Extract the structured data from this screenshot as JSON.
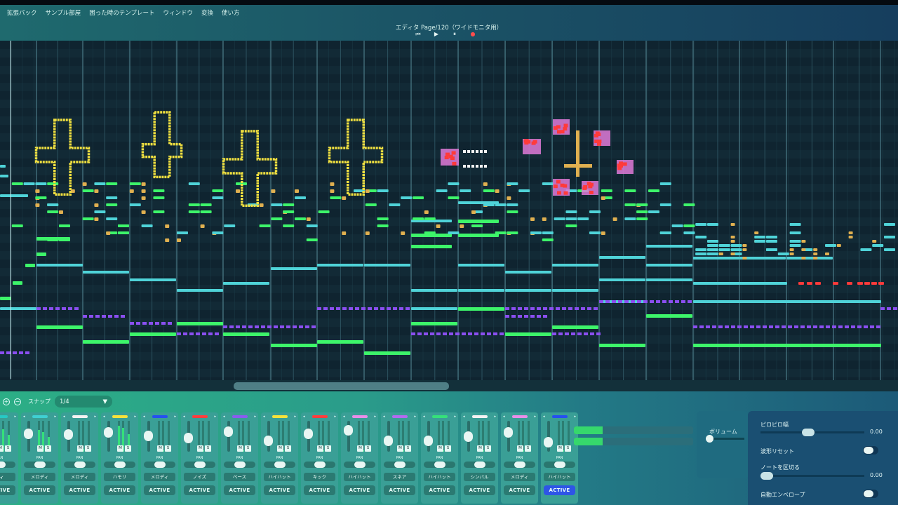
{
  "menubar": [
    "拡張パック",
    "サンプル部屋",
    "困った時のテンプレート",
    "ウィンドウ",
    "変換",
    "使い方"
  ],
  "editor_title": "エディタ Page/120（ワイドモニタ用）",
  "transport": {
    "prev": "⏮",
    "play": "▶",
    "pause": "⏸",
    "record": "●"
  },
  "snap": {
    "zoom_in": "+",
    "zoom_out": "−",
    "label": "スナップ",
    "value": "1/4",
    "caret": "▼"
  },
  "channels": [
    {
      "name": "ディ",
      "color": "#26c9c4",
      "fader": 0.7,
      "meter": 0.8,
      "pan": 0.5,
      "active": "ACTIVE",
      "on": false
    },
    {
      "name": "メロディ",
      "color": "#3fd0d2",
      "fader": 0.65,
      "meter": 0.7,
      "pan": 0.5,
      "active": "ACTIVE",
      "on": false
    },
    {
      "name": "メロディ",
      "color": "#f2f2f2",
      "fader": 0.6,
      "meter": 0.1,
      "pan": 0.5,
      "active": "ACTIVE",
      "on": false
    },
    {
      "name": "ハモリ",
      "color": "#f6e23b",
      "fader": 0.7,
      "meter": 0.85,
      "pan": 0.5,
      "active": "ACTIVE",
      "on": false
    },
    {
      "name": "メロディ",
      "color": "#2550f0",
      "fader": 0.55,
      "meter": 0.05,
      "pan": 0.5,
      "active": "ACTIVE",
      "on": false
    },
    {
      "name": "ノイズ",
      "color": "#ff3d3d",
      "fader": 0.45,
      "meter": 0.05,
      "pan": 0.5,
      "active": "ACTIVE",
      "on": false
    },
    {
      "name": "ベース",
      "color": "#8a5cf0",
      "fader": 0.75,
      "meter": 0.05,
      "pan": 0.5,
      "active": "ACTIVE",
      "on": false
    },
    {
      "name": "ハイハット",
      "color": "#f6e23b",
      "fader": 0.3,
      "meter": 0.05,
      "pan": 0.5,
      "active": "ACTIVE",
      "on": false
    },
    {
      "name": "キック",
      "color": "#ff3d3d",
      "fader": 0.65,
      "meter": 0.05,
      "pan": 0.5,
      "active": "ACTIVE",
      "on": false
    },
    {
      "name": "ハイハット",
      "color": "#e88ee8",
      "fader": 0.8,
      "meter": 0.05,
      "pan": 0.5,
      "active": "ACTIVE",
      "on": false
    },
    {
      "name": "スネア",
      "color": "#b36af0",
      "fader": 0.3,
      "meter": 0.05,
      "pan": 0.5,
      "active": "ACTIVE",
      "on": false
    },
    {
      "name": "ハイハット",
      "color": "#35e07a",
      "fader": 0.3,
      "meter": 0.05,
      "pan": 0.5,
      "active": "ACTIVE",
      "on": false
    },
    {
      "name": "シンバル",
      "color": "#f2f2f2",
      "fader": 0.5,
      "meter": 0.05,
      "pan": 0.5,
      "active": "ACTIVE",
      "on": false
    },
    {
      "name": "メロディ",
      "color": "#e88ee8",
      "fader": 0.7,
      "meter": 0.05,
      "pan": 0.5,
      "active": "ACTIVE",
      "on": false
    },
    {
      "name": "ハイハット",
      "color": "#2550f0",
      "fader": 0.25,
      "meter": 0.05,
      "pan": 0.5,
      "active": "ACTIVE",
      "on": true
    }
  ],
  "channel_labels": {
    "pan": "PAN",
    "mute": "M",
    "solo": "S"
  },
  "levels": [
    0.24,
    0.24
  ],
  "volume": {
    "label": "ボリューム",
    "value": 0.0
  },
  "effects": {
    "pipo_label": "ピロピロ幅",
    "pipo_value": "0.00",
    "pipo_level": 0.45,
    "wave_reset_label": "波形リセット",
    "note_split_label": "ノートを区切る",
    "note_split_value": "0.00",
    "note_split_level": 0.0,
    "auto_env_label": "自動エンベロープ"
  },
  "colors": {
    "green": "#3df56a",
    "cyan": "#4fd3d8",
    "purple": "#8a4ff0",
    "yellow": "#f0e040",
    "orange": "#e0b050",
    "red": "#ff3a3a",
    "pink": "#e07ad8"
  },
  "scroll": {
    "position": 0.26,
    "visible": 0.24
  }
}
